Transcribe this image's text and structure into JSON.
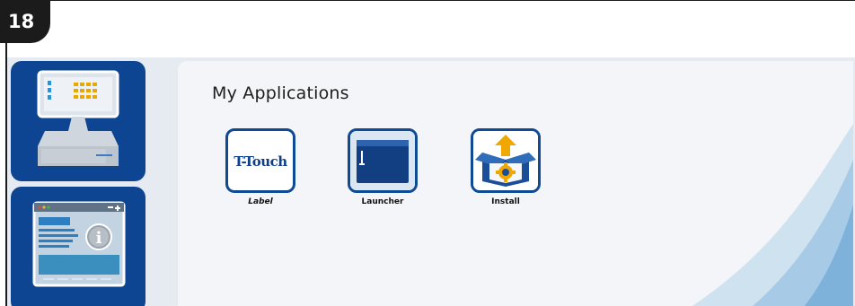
{
  "step": {
    "number": "18"
  },
  "sidebar": {
    "items": [
      {
        "id": "pos-terminal",
        "icon": "pos-terminal-icon"
      },
      {
        "id": "info",
        "icon": "info-window-icon"
      }
    ]
  },
  "main": {
    "title": "My Applications",
    "apps": [
      {
        "label": "Label",
        "icon": "t-touch-icon",
        "logo_text": "T-Touch"
      },
      {
        "label": "Launcher",
        "icon": "folder-launcher-icon"
      },
      {
        "label": "Install",
        "icon": "install-box-icon"
      }
    ]
  },
  "colors": {
    "accent": "#0e4592",
    "panel": "#f3f5f8",
    "background": "#e6ebf2",
    "badge": "#1b1b1b"
  }
}
